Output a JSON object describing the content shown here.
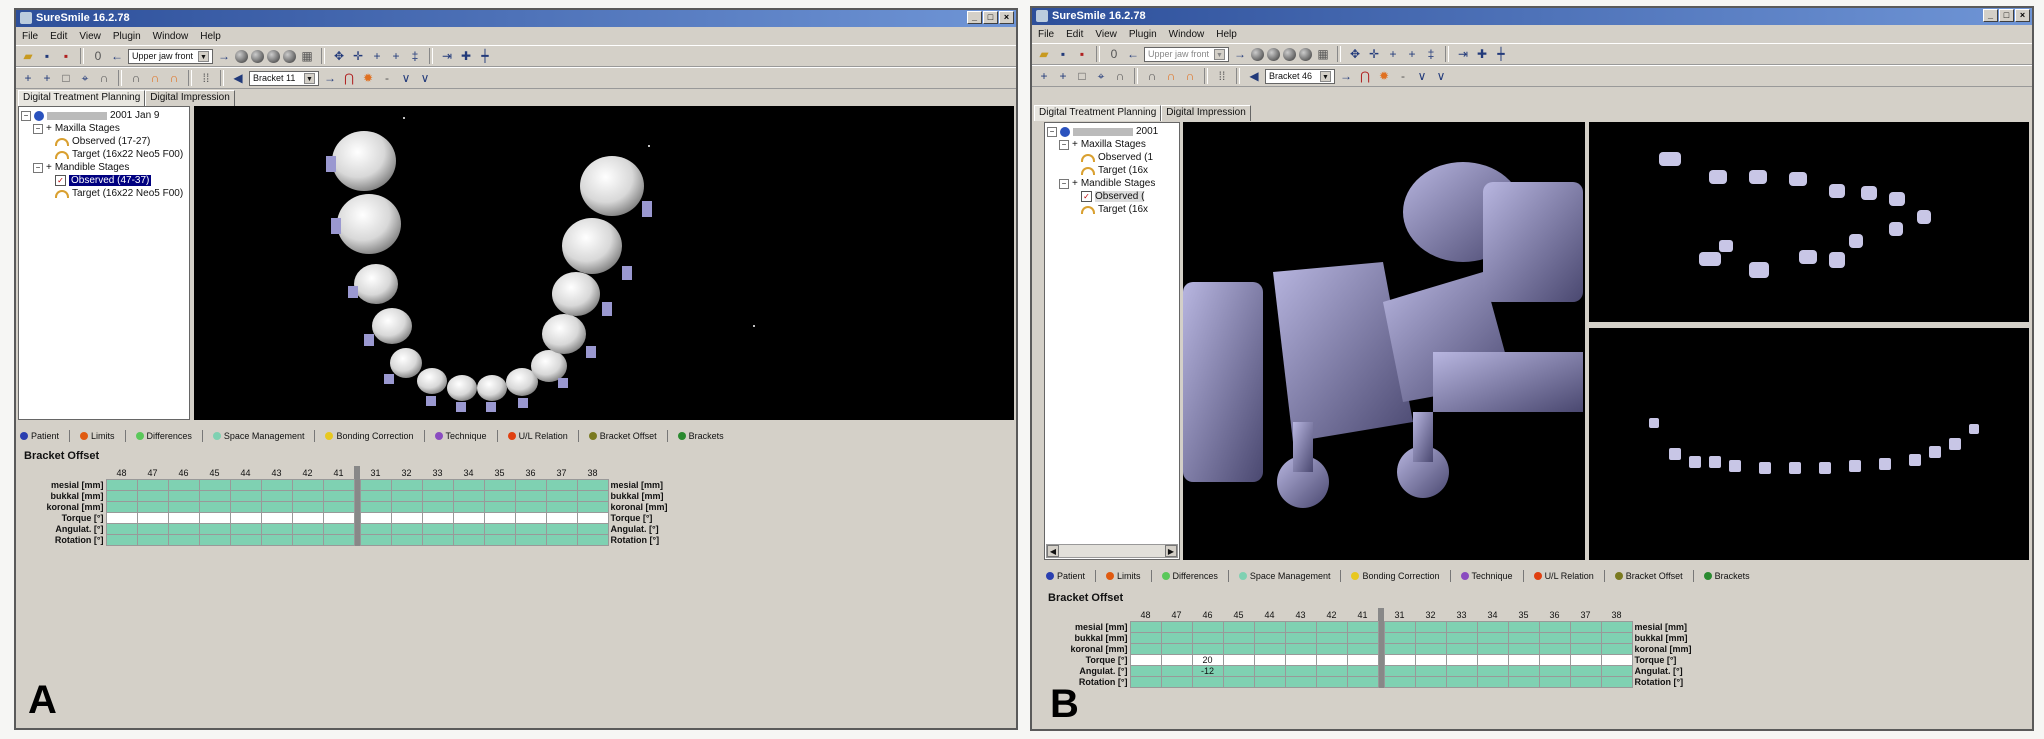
{
  "panelA": {
    "app_title": "SureSmile 16.2.78",
    "menu": [
      "File",
      "Edit",
      "View",
      "Plugin",
      "Window",
      "Help"
    ],
    "toolbar": {
      "jaw_view": "Upper jaw front",
      "bracket": "Bracket 11"
    },
    "tabs": [
      "Digital Treatment Planning",
      "Digital Impression"
    ],
    "tree": {
      "patient": "2001 Jan 9",
      "maxilla": "Maxilla Stages",
      "maxilla_observed": "Observed (17-27)",
      "maxilla_target": "Target (16x22 Neo5 F00)",
      "mandible": "Mandible Stages",
      "mandible_observed": "Observed (47-37)",
      "mandible_target": "Target (16x22 Neo5 F00)"
    },
    "legend": [
      "Patient",
      "Limits",
      "Differences",
      "Space Management",
      "Bonding Correction",
      "Technique",
      "U/L Relation",
      "Bracket Offset",
      "Brackets"
    ],
    "section_title": "Bracket Offset",
    "teeth": [
      "48",
      "47",
      "46",
      "45",
      "44",
      "43",
      "42",
      "41",
      "31",
      "32",
      "33",
      "34",
      "35",
      "36",
      "37",
      "38"
    ],
    "rows_left": [
      "mesial [mm]",
      "bukkal [mm]",
      "koronal [mm]",
      "Torque [°]",
      "Angulat. [°]",
      "Rotation [°]"
    ],
    "rows_right": [
      "mesial [mm]",
      "bukkal [mm]",
      "koronal [mm]",
      "Torque [°]",
      "Angulat. [°]",
      "Rotation [°]"
    ],
    "letter": "A"
  },
  "panelB": {
    "app_title": "SureSmile 16.2.78",
    "menu": [
      "File",
      "Edit",
      "View",
      "Plugin",
      "Window",
      "Help"
    ],
    "toolbar": {
      "jaw_view": "Upper jaw front",
      "bracket": "Bracket 46"
    },
    "tabs": [
      "Digital Treatment Planning",
      "Digital Impression"
    ],
    "tree": {
      "patient": "2001",
      "maxilla": "Maxilla Stages",
      "maxilla_observed": "Observed (1",
      "maxilla_target": "Target (16x",
      "mandible": "Mandible Stages",
      "mandible_observed": "Observed (",
      "mandible_target": "Target (16x"
    },
    "legend": [
      "Patient",
      "Limits",
      "Differences",
      "Space Management",
      "Bonding Correction",
      "Technique",
      "U/L Relation",
      "Bracket Offset",
      "Brackets"
    ],
    "section_title": "Bracket Offset",
    "teeth": [
      "48",
      "47",
      "46",
      "45",
      "44",
      "43",
      "42",
      "41",
      "31",
      "32",
      "33",
      "34",
      "35",
      "36",
      "37",
      "38"
    ],
    "rows_left": [
      "mesial [mm]",
      "bukkal [mm]",
      "koronal [mm]",
      "Torque [°]",
      "Angulat. [°]",
      "Rotation [°]"
    ],
    "rows_right": [
      "mesial [mm]",
      "bukkal [mm]",
      "koronal [mm]",
      "Torque [°]",
      "Angulat. [°]",
      "Rotation [°]"
    ],
    "torque_46": "20",
    "angulat_46": "-12",
    "letter": "B"
  },
  "colors": {
    "legend": [
      "#2a3fb0",
      "#e05a10",
      "#5ac85a",
      "#7fd1b2",
      "#e8c820",
      "#8a4cc0",
      "#e04010",
      "#7a7a20",
      "#2a8a30"
    ],
    "grid_green": "#7fd1b2",
    "viewport_bg": "#000000",
    "selection": "#000080"
  }
}
